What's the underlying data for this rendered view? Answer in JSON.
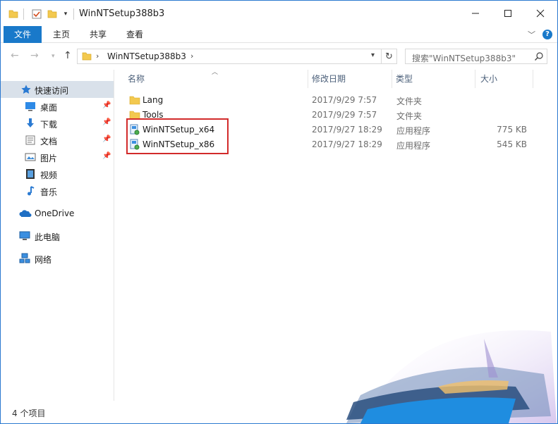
{
  "window": {
    "title": "WinNTSetup388b3",
    "minimize_icon": "minimize-icon",
    "maximize_icon": "maximize-icon",
    "close_icon": "close-icon"
  },
  "ribbon": {
    "tabs": [
      "文件",
      "主页",
      "共享",
      "查看"
    ],
    "help_label": "?"
  },
  "address": {
    "crumb": "WinNTSetup388b3",
    "search_placeholder": "搜索\"WinNTSetup388b3\""
  },
  "nav": {
    "items": [
      {
        "label": "快速访问",
        "icon": "star-icon",
        "selected": true
      },
      {
        "label": "桌面",
        "icon": "desktop-icon",
        "pinned": true
      },
      {
        "label": "下载",
        "icon": "download-icon",
        "pinned": true
      },
      {
        "label": "文档",
        "icon": "document-icon",
        "pinned": true
      },
      {
        "label": "图片",
        "icon": "pictures-icon",
        "pinned": true
      },
      {
        "label": "视频",
        "icon": "video-icon"
      },
      {
        "label": "音乐",
        "icon": "music-icon"
      },
      {
        "label": "OneDrive",
        "icon": "onedrive-icon"
      },
      {
        "label": "此电脑",
        "icon": "computer-icon"
      },
      {
        "label": "网络",
        "icon": "network-icon"
      }
    ]
  },
  "columns": {
    "name": "名称",
    "date": "修改日期",
    "type": "类型",
    "size": "大小"
  },
  "files": [
    {
      "name": "Lang",
      "date": "2017/9/29 7:57",
      "type": "文件夹",
      "size": "",
      "icon": "folder-icon"
    },
    {
      "name": "Tools",
      "date": "2017/9/29 7:57",
      "type": "文件夹",
      "size": "",
      "icon": "folder-icon"
    },
    {
      "name": "WinNTSetup_x64",
      "date": "2017/9/27 18:29",
      "type": "应用程序",
      "size": "775 KB",
      "icon": "application-icon"
    },
    {
      "name": "WinNTSetup_x86",
      "date": "2017/9/27 18:29",
      "type": "应用程序",
      "size": "545 KB",
      "icon": "application-icon"
    }
  ],
  "status": {
    "item_count": "4 个项目"
  },
  "colors": {
    "accent": "#1979ca",
    "highlight_border": "#d22b2b",
    "selected_nav": "#d9e1ea"
  }
}
